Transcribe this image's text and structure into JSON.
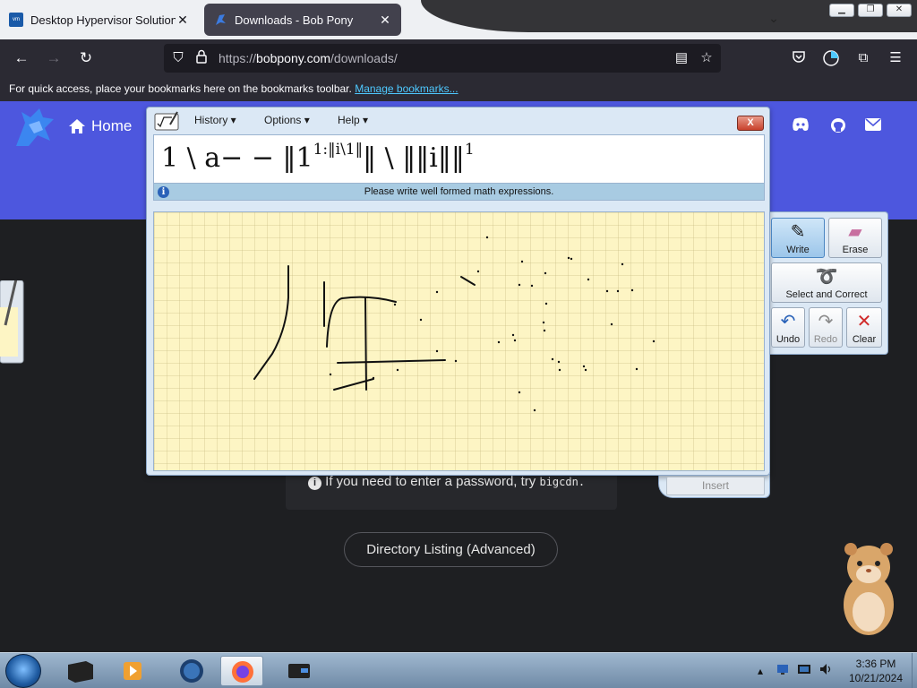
{
  "browser": {
    "tabs": [
      {
        "title": "Desktop Hypervisor Solutions |",
        "favicon": "vmware-icon",
        "active": false
      },
      {
        "title": "Downloads - Bob Pony",
        "favicon": "bobpony-icon",
        "active": true
      }
    ],
    "url_scheme": "https://",
    "url_host": "bobpony.com",
    "url_path": "/downloads/",
    "bookmarks_hint": "For quick access, place your bookmarks here on the bookmarks toolbar.",
    "bookmarks_link": "Manage bookmarks..."
  },
  "page": {
    "home_label": "Home",
    "password_prefix": "If you need to enter a password, try",
    "password_value": "bigcdn.",
    "directory_button": "Directory Listing (Advanced)"
  },
  "math_panel": {
    "menu": [
      "History",
      "Options",
      "Help"
    ],
    "close_label": "X",
    "expression_main": "1 \\ a− − ‖1",
    "expression_sup": "1:‖i\\1‖",
    "expression_tail": "‖ \\ ‖‖i‖‖",
    "expression_tail_sup": "1",
    "status": "Please write well formed math expressions.",
    "tools": [
      {
        "label": "Write",
        "icon": "pen-icon",
        "active": true
      },
      {
        "label": "Erase",
        "icon": "eraser-icon",
        "active": false
      },
      {
        "label": "Select and Correct",
        "icon": "lasso-icon",
        "active": false
      },
      {
        "label": "Undo",
        "icon": "undo-icon",
        "enabled": true
      },
      {
        "label": "Redo",
        "icon": "redo-icon",
        "enabled": false
      },
      {
        "label": "Clear",
        "icon": "clear-icon",
        "enabled": true
      }
    ],
    "insert_label": "Insert"
  },
  "taskbar": {
    "time": "3:36 PM",
    "date": "10/21/2024"
  },
  "colors": {
    "hero": "#4d57de",
    "browser_chrome": "#2b2a33",
    "link": "#4ec9ff",
    "writing_pad": "#fdf5c4"
  }
}
